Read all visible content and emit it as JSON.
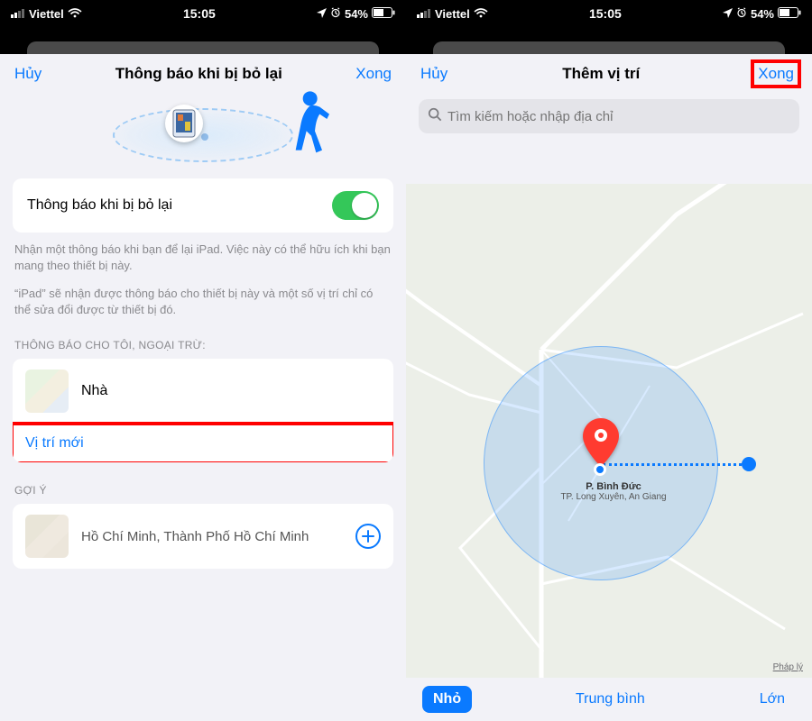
{
  "status": {
    "carrier": "Viettel",
    "time": "15:05",
    "battery": "54%"
  },
  "left": {
    "nav": {
      "cancel": "Hủy",
      "title": "Thông báo khi bị bỏ lại",
      "done": "Xong"
    },
    "toggleCard": {
      "label": "Thông báo khi bị bỏ lại",
      "on": true
    },
    "desc1": "Nhận một thông báo khi bạn để lại iPad. Việc này có thể hữu ích khi bạn mang theo thiết bị này.",
    "desc2": "“iPad” sẽ nhận được thông báo cho thiết bị này và một số vị trí chỉ có thể sửa đổi được từ thiết bị đó.",
    "exceptHeader": "THÔNG BÁO CHO TÔI, NGOẠI TRỪ:",
    "rows": {
      "home": "Nhà",
      "newLocation": "Vị trí mới"
    },
    "suggestHeader": "GỢI Ý",
    "suggestion": "Hồ Chí Minh, Thành Phố Hồ Chí Minh"
  },
  "right": {
    "nav": {
      "cancel": "Hủy",
      "title": "Thêm vị trí",
      "done": "Xong"
    },
    "searchPlaceholder": "Tìm kiếm hoặc nhập địa chỉ",
    "place": {
      "name": "P. Bình Đức",
      "sub": "TP. Long Xuyên, An Giang"
    },
    "legal": "Pháp lý",
    "segments": {
      "small": "Nhỏ",
      "medium": "Trung bình",
      "large": "Lớn"
    }
  }
}
